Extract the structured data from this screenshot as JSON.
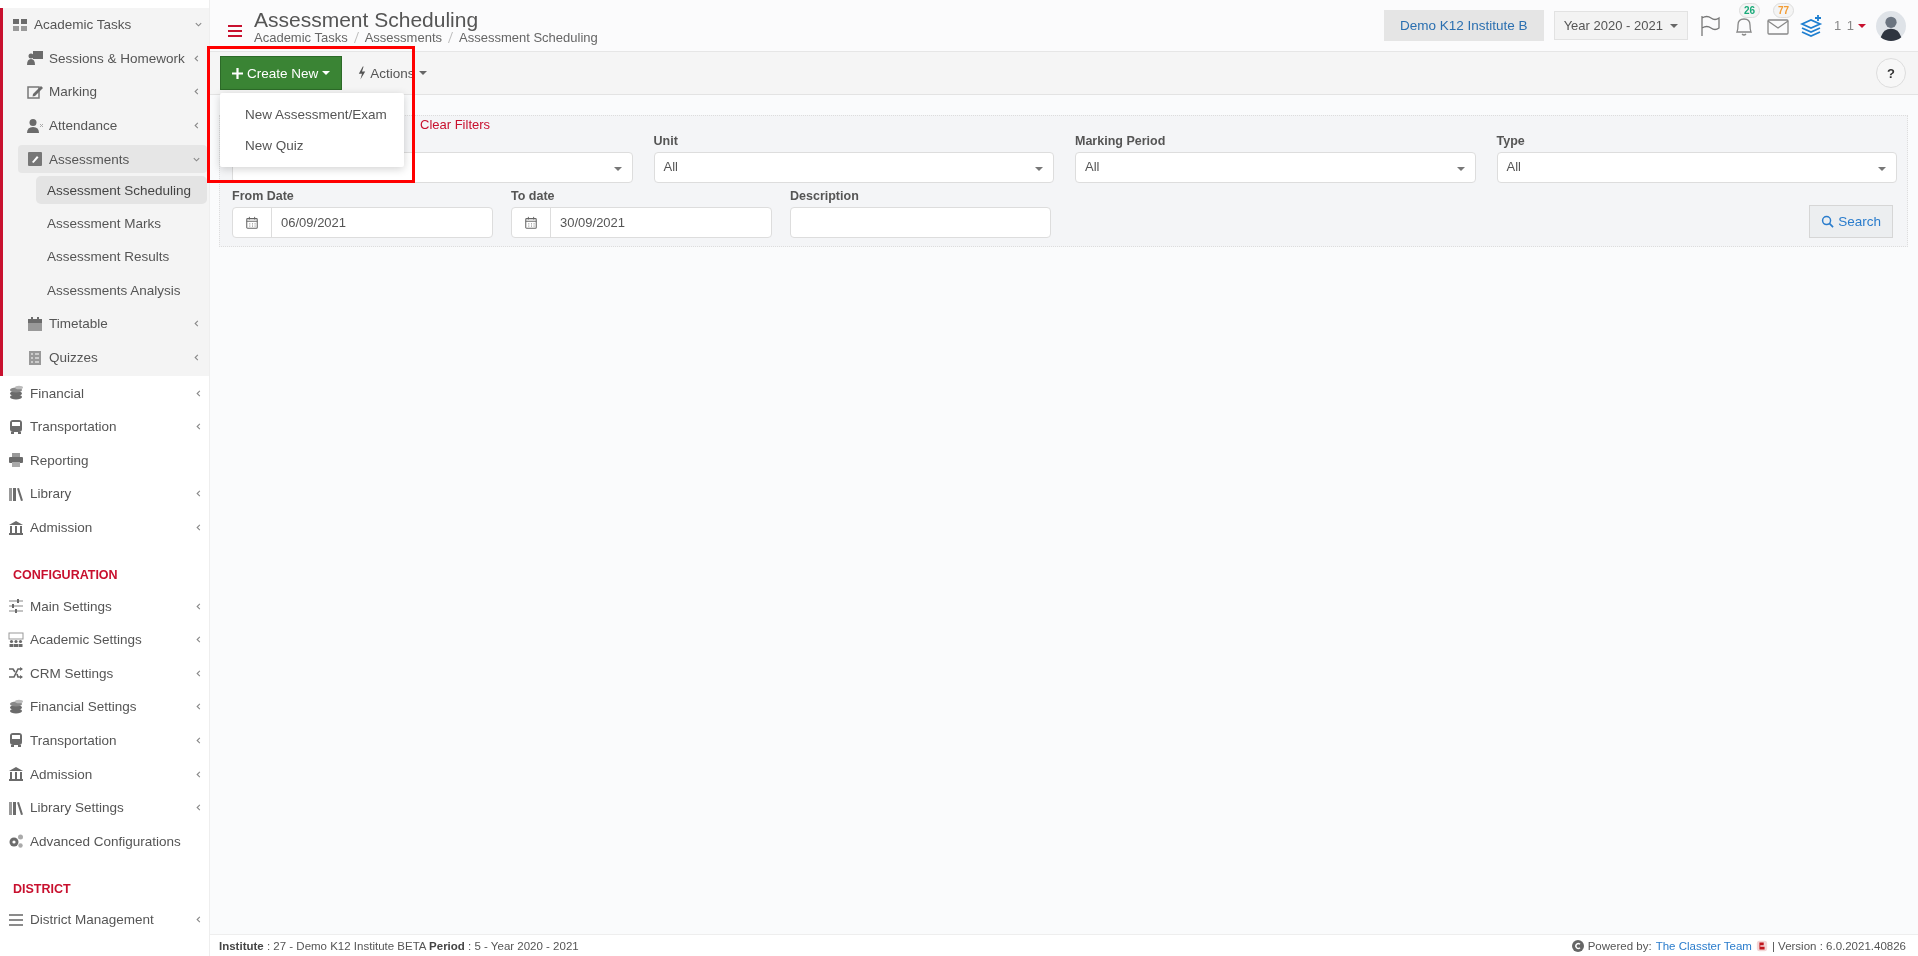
{
  "sidebar": {
    "items": [
      {
        "kind": "menu",
        "label": "Academic Tasks",
        "expanded": true,
        "selected": false,
        "children": [
          {
            "kind": "menu",
            "label": "Sessions & Homework",
            "expanded": false,
            "selected": false
          },
          {
            "kind": "menu",
            "label": "Marking",
            "expanded": false,
            "selected": false
          },
          {
            "kind": "menu",
            "label": "Attendance",
            "expanded": false,
            "selected": false
          },
          {
            "kind": "menu",
            "label": "Assessments",
            "expanded": true,
            "selected": true,
            "children": [
              {
                "kind": "link",
                "label": "Assessment Scheduling",
                "selected": true
              },
              {
                "kind": "link",
                "label": "Assessment Marks",
                "selected": false
              },
              {
                "kind": "link",
                "label": "Assessment Results",
                "selected": false
              },
              {
                "kind": "link",
                "label": "Assessments Analysis",
                "selected": false
              }
            ]
          },
          {
            "kind": "menu",
            "label": "Timetable",
            "expanded": false,
            "selected": false
          },
          {
            "kind": "menu",
            "label": "Quizzes",
            "expanded": false,
            "selected": false
          }
        ]
      },
      {
        "kind": "menu",
        "label": "Financial",
        "expanded": false,
        "selected": false
      },
      {
        "kind": "menu",
        "label": "Transportation",
        "expanded": false,
        "selected": false
      },
      {
        "kind": "link",
        "label": "Reporting",
        "selected": false
      },
      {
        "kind": "menu",
        "label": "Library",
        "expanded": false,
        "selected": false
      },
      {
        "kind": "menu",
        "label": "Admission",
        "expanded": false,
        "selected": false
      },
      {
        "kind": "heading",
        "label": "CONFIGURATION"
      },
      {
        "kind": "menu",
        "label": "Main Settings",
        "expanded": false,
        "selected": false
      },
      {
        "kind": "menu",
        "label": "Academic Settings",
        "expanded": false,
        "selected": false
      },
      {
        "kind": "menu",
        "label": "CRM Settings",
        "expanded": false,
        "selected": false
      },
      {
        "kind": "menu",
        "label": "Financial Settings",
        "expanded": false,
        "selected": false
      },
      {
        "kind": "menu",
        "label": "Transportation",
        "expanded": false,
        "selected": false
      },
      {
        "kind": "menu",
        "label": "Admission",
        "expanded": false,
        "selected": false
      },
      {
        "kind": "menu",
        "label": "Library Settings",
        "expanded": false,
        "selected": false
      },
      {
        "kind": "link",
        "label": "Advanced Configurations",
        "selected": false
      },
      {
        "kind": "heading",
        "label": "DISTRICT"
      },
      {
        "kind": "menu",
        "label": "District Management",
        "expanded": false,
        "selected": false
      }
    ]
  },
  "header": {
    "title": "Assessment Scheduling",
    "breadcrumb": [
      "Academic Tasks",
      "Assessments",
      "Assessment Scheduling"
    ],
    "institute": "Demo K12 Institute B",
    "year": "Year 2020 - 2021",
    "notifications": [
      {
        "kind": "bell",
        "count": "26",
        "color": "#1aaa7a"
      },
      {
        "kind": "mail",
        "count": "77",
        "color": "#f39c34"
      }
    ],
    "user": "1 1"
  },
  "toolbar": {
    "create_button": "Create New",
    "actions_button": "Actions",
    "help_button": "?",
    "dropdown": {
      "open": true,
      "items": [
        "New Assessment/Exam",
        "New Quiz"
      ]
    }
  },
  "filters": {
    "clear_link": "Clear Filters",
    "fields": [
      {
        "kind": "select"
      },
      {
        "kind": "select",
        "label": "Unit",
        "value": "All"
      },
      {
        "kind": "select",
        "label": "Marking Period",
        "value": "All"
      },
      {
        "kind": "select",
        "label": "Type",
        "value": "All"
      },
      {
        "kind": "date",
        "label": "From Date",
        "value": "06/09/2021"
      },
      {
        "kind": "date",
        "label": "To date",
        "value": "30/09/2021"
      },
      {
        "kind": "text",
        "label": "Description"
      }
    ],
    "search_button": "Search"
  },
  "footer": {
    "info": "**Institute** : 27 - Demo K12 Institute BETA **Period** : 5 - Year 2020 - 2021",
    "powered_label": "Powered by:",
    "powered_link": "The Classter Team",
    "version": "| Version : 6.0.2021.40826"
  }
}
